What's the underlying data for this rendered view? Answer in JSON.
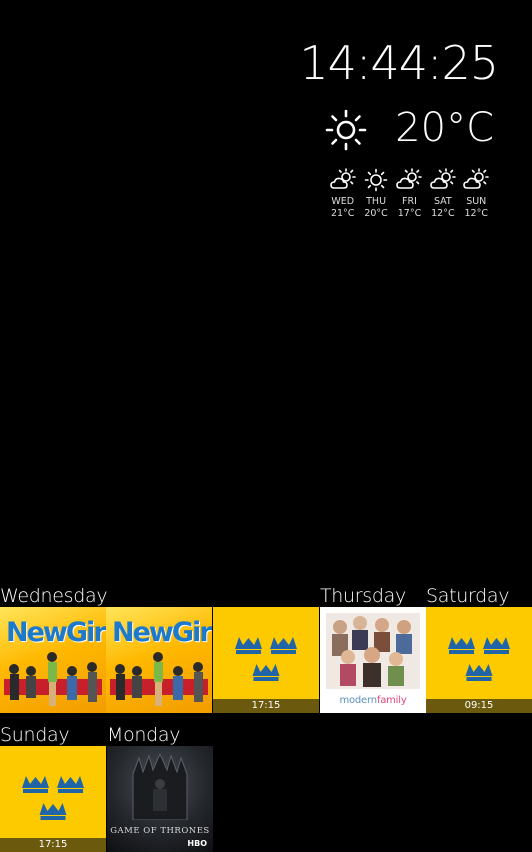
{
  "clock": {
    "time": "14:44:25"
  },
  "weather": {
    "current_temp": "20°C",
    "current_icon": "sun-icon",
    "forecast": [
      {
        "day": "WED",
        "temp": "21°C",
        "icon": "partly-cloudy-icon"
      },
      {
        "day": "THU",
        "temp": "20°C",
        "icon": "sun-icon"
      },
      {
        "day": "FRI",
        "temp": "17°C",
        "icon": "partly-cloudy-icon"
      },
      {
        "day": "SAT",
        "temp": "12°C",
        "icon": "partly-cloudy-icon"
      },
      {
        "day": "SUN",
        "temp": "12°C",
        "icon": "partly-cloudy-icon"
      }
    ]
  },
  "schedule": {
    "row1": {
      "labels": {
        "wednesday": "Wednesday",
        "thursday": "Thursday",
        "saturday": "Saturday"
      },
      "tiles": [
        {
          "type": "poster",
          "title_a": "New",
          "title_b": "Girl"
        },
        {
          "type": "poster",
          "title_a": "New",
          "title_b": "Girl"
        },
        {
          "type": "crowns",
          "time": "17:15"
        },
        {
          "type": "poster",
          "title_a": "modern",
          "title_b": "family"
        },
        {
          "type": "crowns",
          "time": "09:15"
        }
      ]
    },
    "row2": {
      "labels": {
        "sunday": "Sunday",
        "monday": "Monday"
      },
      "tiles": [
        {
          "type": "crowns",
          "time": "17:15"
        },
        {
          "type": "poster",
          "title": "GAME OF THRONES",
          "network": "HBO"
        }
      ]
    }
  },
  "colors": {
    "background": "#000000",
    "crowns_yellow": "#fdca00",
    "crowns_blue": "#1f65a8",
    "time_bar": "#6b5a0d"
  }
}
